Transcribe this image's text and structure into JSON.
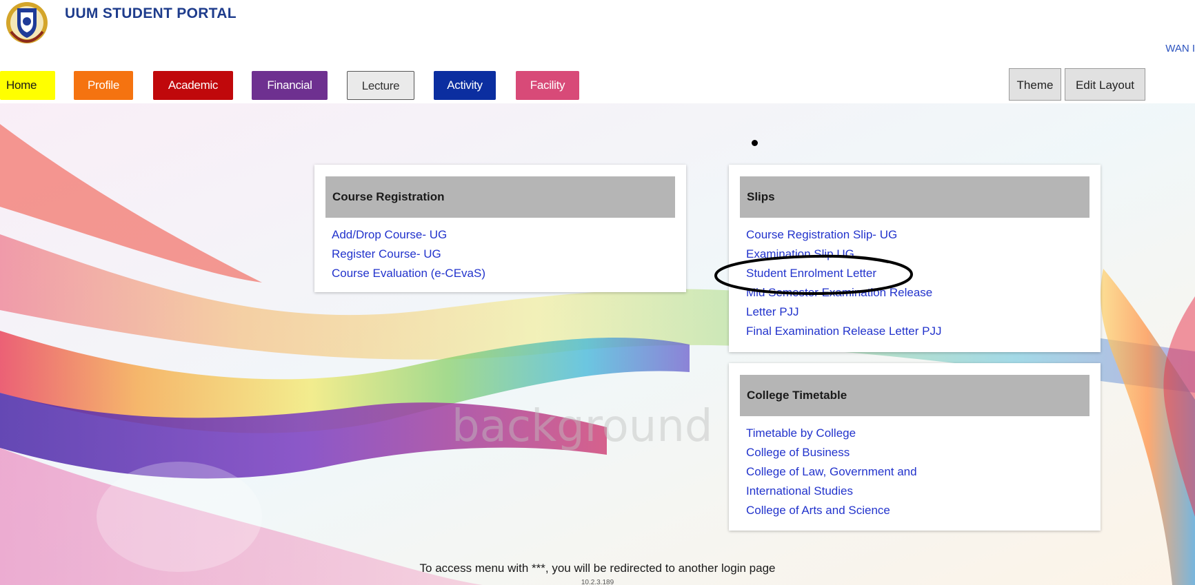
{
  "header": {
    "title": "UUM STUDENT PORTAL",
    "user_name": "WAN I"
  },
  "nav": {
    "home": "Home",
    "profile": "Profile",
    "academic": "Academic",
    "financial": "Financial",
    "lecture": "Lecture",
    "activity": "Activity",
    "facility": "Facility"
  },
  "toolbar": {
    "theme": "Theme",
    "edit_layout": "Edit Layout"
  },
  "panels": {
    "course_registration": {
      "title": "Course Registration",
      "links": [
        "Add/Drop Course- UG",
        "Register Course- UG",
        "Course Evaluation (e-CEvaS)"
      ]
    },
    "slips": {
      "title": "Slips",
      "links": [
        "Course Registration Slip- UG",
        "Examination Slip UG",
        "Student Enrolment Letter",
        "Mid Semester Examination Release",
        "Letter PJJ",
        "Final Examination Release Letter PJJ"
      ]
    },
    "college_timetable": {
      "title": "College Timetable",
      "links": [
        "Timetable by College",
        "College of Business",
        "College of Law, Government and",
        "International Studies",
        "College of Arts and Science"
      ]
    }
  },
  "background_watermark": "background",
  "footer": {
    "note": "To access menu with ***, you will be redirected to another login page",
    "ip": "10.2.3.189"
  },
  "colors": {
    "title": "#1e3c8c",
    "link": "#2233cc",
    "home": "#ffff00",
    "profile": "#f57310",
    "academic": "#c0080b",
    "financial": "#6e3090",
    "activity": "#0b2ea0",
    "facility": "#d84a78",
    "panel_header": "#b5b5b5"
  }
}
